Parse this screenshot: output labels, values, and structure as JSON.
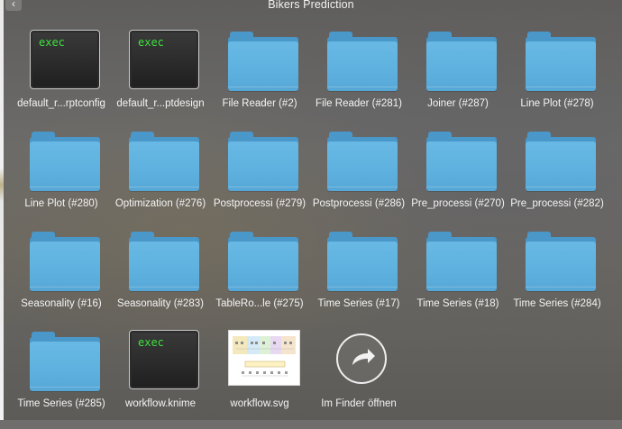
{
  "window": {
    "title": "Bikers Prediction",
    "back_glyph": "‹"
  },
  "items": [
    {
      "type": "exec",
      "label": "default_r...rptconfig",
      "icon_text": "exec"
    },
    {
      "type": "exec",
      "label": "default_r...ptdesign",
      "icon_text": "exec"
    },
    {
      "type": "folder",
      "label": "File Reader (#2)"
    },
    {
      "type": "folder",
      "label": "File Reader (#281)"
    },
    {
      "type": "folder",
      "label": "Joiner (#287)"
    },
    {
      "type": "folder",
      "label": "Line Plot (#278)"
    },
    {
      "type": "folder",
      "label": "Line Plot (#280)"
    },
    {
      "type": "folder",
      "label": "Optimization (#276)"
    },
    {
      "type": "folder",
      "label": "Postprocessi (#279)"
    },
    {
      "type": "folder",
      "label": "Postprocessi (#286)"
    },
    {
      "type": "folder",
      "label": "Pre_processi (#270)"
    },
    {
      "type": "folder",
      "label": "Pre_processi (#282)"
    },
    {
      "type": "folder",
      "label": "Seasonality (#16)"
    },
    {
      "type": "folder",
      "label": "Seasonality (#283)"
    },
    {
      "type": "folder",
      "label": "TableRo...le (#275)"
    },
    {
      "type": "folder",
      "label": "Time Series (#17)"
    },
    {
      "type": "folder",
      "label": "Time Series (#18)"
    },
    {
      "type": "folder",
      "label": "Time Series (#284)"
    },
    {
      "type": "folder",
      "label": "Time Series (#285)"
    },
    {
      "type": "exec",
      "label": "workflow.knime",
      "icon_text": "exec"
    },
    {
      "type": "svgthumb",
      "label": "workflow.svg"
    },
    {
      "type": "finder",
      "label": "Im Finder öffnen"
    }
  ],
  "colors": {
    "folder_front": "#5fb2df",
    "folder_back": "#4a97c9",
    "exec_text": "#3ee03e"
  }
}
